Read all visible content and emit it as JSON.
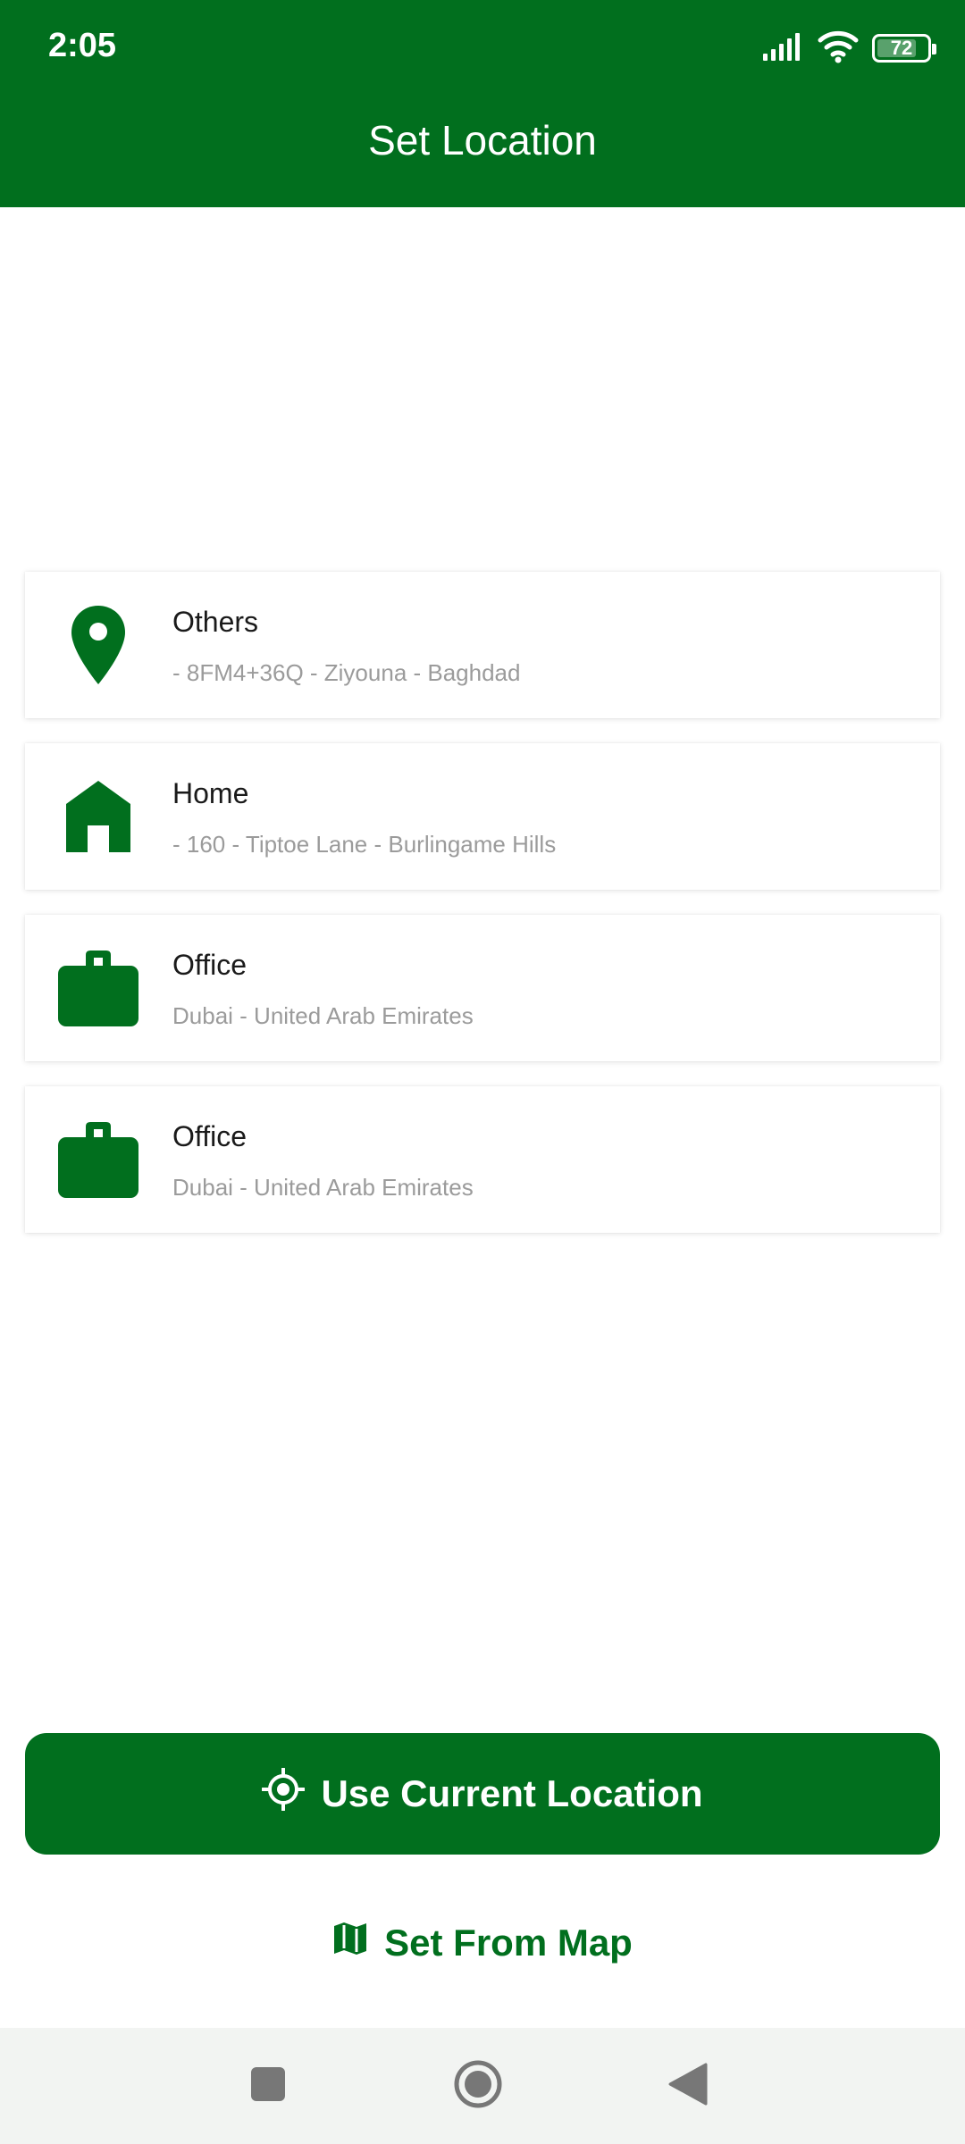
{
  "status_bar": {
    "time": "2:05",
    "battery_level": "72",
    "icons": [
      "signal-icon",
      "wifi-icon",
      "battery-icon"
    ]
  },
  "app_bar": {
    "title": "Set Location"
  },
  "locations": [
    {
      "icon": "pin-icon",
      "title": "Others",
      "subtitle": "- 8FM4+36Q - Ziyouna - Baghdad"
    },
    {
      "icon": "home-icon",
      "title": "Home",
      "subtitle": "- 160 - Tiptoe Lane - Burlingame Hills"
    },
    {
      "icon": "briefcase-icon",
      "title": "Office",
      "subtitle": "Dubai - United Arab Emirates"
    },
    {
      "icon": "briefcase-icon",
      "title": "Office",
      "subtitle": "Dubai - United Arab Emirates"
    }
  ],
  "actions": {
    "use_current_location": "Use Current Location",
    "set_from_map": "Set From Map"
  },
  "nav_bar": {
    "buttons": [
      "recents-button",
      "home-button",
      "back-button"
    ]
  },
  "colors": {
    "primary": "#016f1e",
    "subtitle": "#9b9b9b",
    "nav_background": "#f2f4f2"
  }
}
